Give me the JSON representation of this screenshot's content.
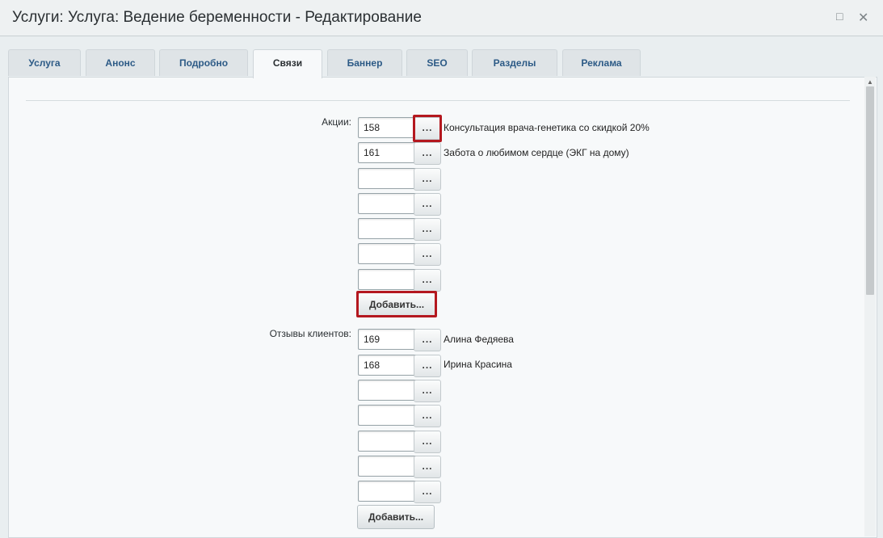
{
  "window": {
    "title": "Услуги: Услуга: Ведение беременности - Редактирование",
    "maximize_glyph": "□",
    "close_glyph": "✕"
  },
  "tabs": [
    {
      "label": "Услуга",
      "active": false
    },
    {
      "label": "Анонс",
      "active": false
    },
    {
      "label": "Подробно",
      "active": false
    },
    {
      "label": "Связи",
      "active": true
    },
    {
      "label": "Баннер",
      "active": false
    },
    {
      "label": "SEO",
      "active": false
    },
    {
      "label": "Разделы",
      "active": false
    },
    {
      "label": "Реклама",
      "active": false
    }
  ],
  "promotions": {
    "label": "Акции:",
    "rows": [
      {
        "value": "158",
        "name": "Консультация врача-генетика со скидкой 20%"
      },
      {
        "value": "161",
        "name": "Забота о любимом сердце (ЭКГ на дому)"
      },
      {
        "value": "",
        "name": ""
      },
      {
        "value": "",
        "name": ""
      },
      {
        "value": "",
        "name": ""
      },
      {
        "value": "",
        "name": ""
      },
      {
        "value": "",
        "name": ""
      }
    ],
    "browse_label": "...",
    "add_label": "Добавить..."
  },
  "reviews": {
    "label": "Отзывы клиентов:",
    "rows": [
      {
        "value": "169",
        "name": "Алина Федяева"
      },
      {
        "value": "168",
        "name": "Ирина Красина"
      },
      {
        "value": "",
        "name": ""
      },
      {
        "value": "",
        "name": ""
      },
      {
        "value": "",
        "name": ""
      },
      {
        "value": "",
        "name": ""
      },
      {
        "value": "",
        "name": ""
      }
    ],
    "browse_label": "...",
    "add_label": "Добавить..."
  },
  "colors": {
    "highlight": "#b4181f",
    "tab_text": "#2c5a86"
  },
  "icons": [
    "maximize-icon",
    "close-icon",
    "scroll-up-arrow-icon"
  ]
}
